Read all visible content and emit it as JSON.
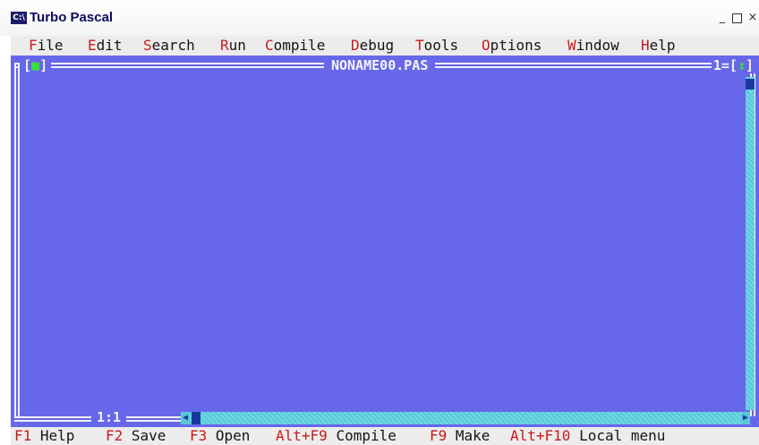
{
  "window": {
    "icon_text": "C:\\",
    "title": "Turbo Pascal",
    "minimize_label": "_",
    "close_label": "×"
  },
  "menu": [
    {
      "hot": "F",
      "rest": "ile"
    },
    {
      "hot": "E",
      "rest": "dit"
    },
    {
      "hot": "S",
      "rest": "earch"
    },
    {
      "hot": "R",
      "rest": "un"
    },
    {
      "hot": "C",
      "rest": "ompile"
    },
    {
      "hot": "D",
      "rest": "ebug"
    },
    {
      "hot": "T",
      "rest": "ools"
    },
    {
      "hot": "O",
      "rest": "ptions"
    },
    {
      "hot": "W",
      "rest": "indow"
    },
    {
      "hot": "H",
      "rest": "elp"
    }
  ],
  "editor": {
    "close_box_left": "[",
    "close_box_glyph": "■",
    "close_box_right": "]",
    "file_name": "NONAME00.PAS",
    "window_number": "1",
    "zoom_glyph": "↕",
    "cursor_position": "1:1"
  },
  "status": [
    {
      "key": "F1",
      "label": "Help"
    },
    {
      "key": "F2",
      "label": "Save"
    },
    {
      "key": "F3",
      "label": "Open"
    },
    {
      "key": "Alt+F9",
      "label": "Compile"
    },
    {
      "key": "F9",
      "label": "Make"
    },
    {
      "key": "Alt+F10",
      "label": "Local menu"
    }
  ],
  "colors": {
    "editor_background": "#6767ea",
    "menu_background": "#ececec",
    "hotkey": "#c81a1a",
    "scrollbar": "#5bc7d6",
    "scroll_thumb": "#183a9e"
  }
}
